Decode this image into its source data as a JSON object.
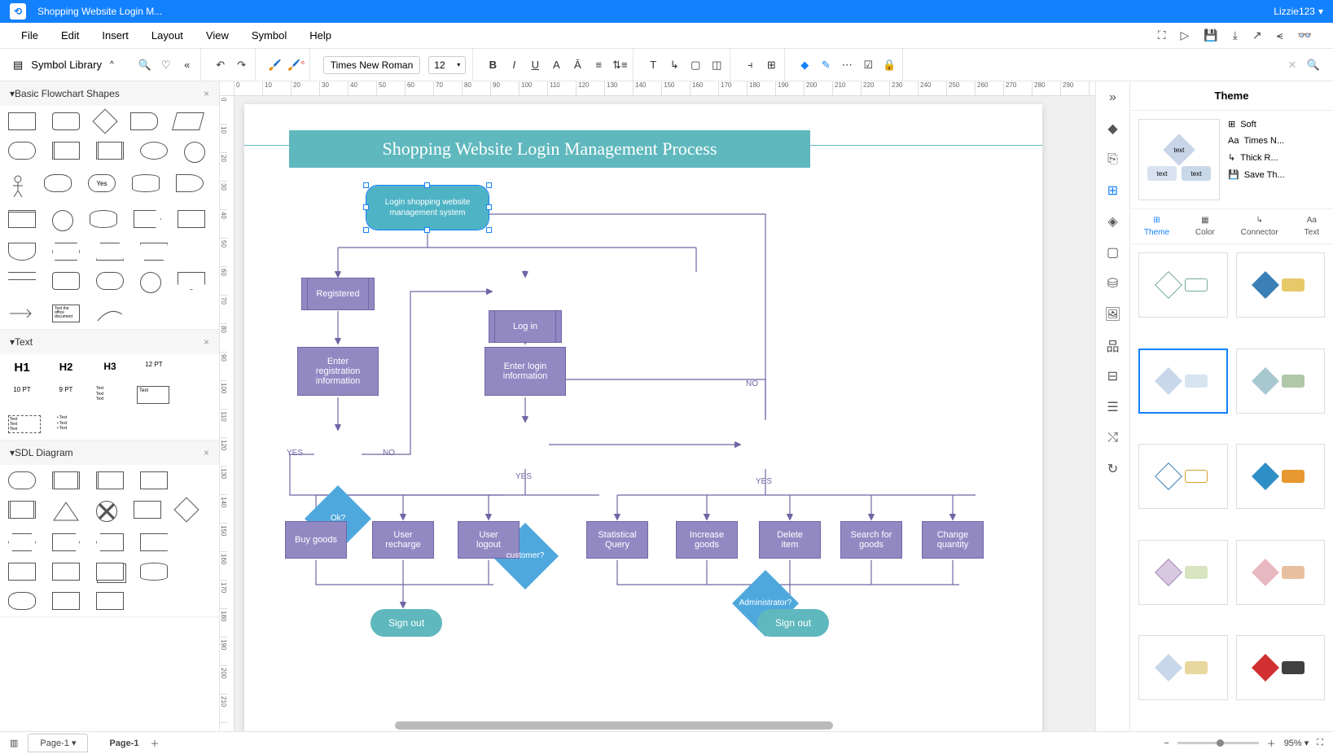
{
  "titlebar": {
    "document_title": "Shopping Website Login M...",
    "user": "Lizzie123"
  },
  "menubar": {
    "items": [
      "File",
      "Edit",
      "Insert",
      "Layout",
      "View",
      "Symbol",
      "Help"
    ]
  },
  "toolbar": {
    "library_label": "Symbol Library",
    "font_name": "Times New Roman",
    "font_size": "12"
  },
  "left_panel": {
    "sections": {
      "flowchart": {
        "title": "Basic Flowchart Shapes"
      },
      "text": {
        "title": "Text",
        "items": [
          "H1",
          "H2",
          "H3",
          "12 PT",
          "10 PT",
          "9 PT"
        ]
      },
      "sdl": {
        "title": "SDL Diagram"
      }
    },
    "shape_label_yes": "Yes"
  },
  "diagram": {
    "title": "Shopping Website Login Management Process",
    "nodes": {
      "start": "Login shopping website management system",
      "registered": "Registered",
      "login": "Log in",
      "enter_reg": "Enter registration information",
      "enter_login": "Enter login information",
      "ok": "Ok?",
      "customer": "customer?",
      "admin": "Administrator?",
      "buy": "Buy goods",
      "recharge": "User recharge",
      "logout": "User logout",
      "stat": "Statistical Query",
      "increase": "Increase goods",
      "delete": "Delete item",
      "search": "Search for goods",
      "change": "Change quantity",
      "signout1": "Sign out",
      "signout2": "Sign out"
    },
    "labels": {
      "yes": "YES",
      "no": "NO"
    }
  },
  "right_panel": {
    "title": "Theme",
    "preview": {
      "txt1": "text",
      "txt2": "text",
      "txt3": "text"
    },
    "options": {
      "soft": "Soft",
      "font": "Times N...",
      "line": "Thick R...",
      "save": "Save Th..."
    },
    "tabs": {
      "theme": "Theme",
      "color": "Color",
      "connector": "Connector",
      "text": "Text"
    }
  },
  "bottombar": {
    "page_label": "Page-1",
    "page_active": "Page-1",
    "zoom": "95%"
  }
}
